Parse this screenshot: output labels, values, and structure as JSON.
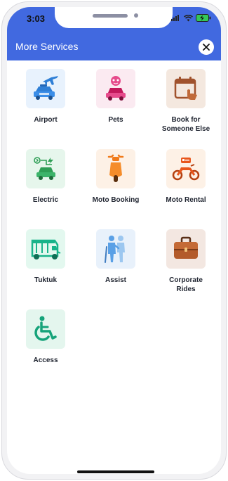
{
  "status_bar": {
    "time": "3:03"
  },
  "header": {
    "title": "More Services"
  },
  "services": [
    {
      "label": "Airport",
      "icon": "airplane-car-icon",
      "bg": "#e8f2fd"
    },
    {
      "label": "Pets",
      "icon": "pet-car-icon",
      "bg": "#fbeaf1"
    },
    {
      "label": "Book for\nSomeone Else",
      "icon": "calendar-hand-icon",
      "bg": "#f4e8df"
    },
    {
      "label": "Electric",
      "icon": "electric-car-icon",
      "bg": "#e6f6ec"
    },
    {
      "label": "Moto Booking",
      "icon": "scooter-icon",
      "bg": "#fdf1e6"
    },
    {
      "label": "Moto Rental",
      "icon": "motorcycle-icon",
      "bg": "#fdf1e6"
    },
    {
      "label": "Tuktuk",
      "icon": "tuktuk-icon",
      "bg": "#e3f8ef"
    },
    {
      "label": "Assist",
      "icon": "assist-people-icon",
      "bg": "#e8f1fb"
    },
    {
      "label": "Corporate\nRides",
      "icon": "briefcase-icon",
      "bg": "#f3e7e1"
    },
    {
      "label": "Access",
      "icon": "wheelchair-icon",
      "bg": "#e4f6ee"
    }
  ],
  "colors": {
    "header": "#4169e0"
  }
}
